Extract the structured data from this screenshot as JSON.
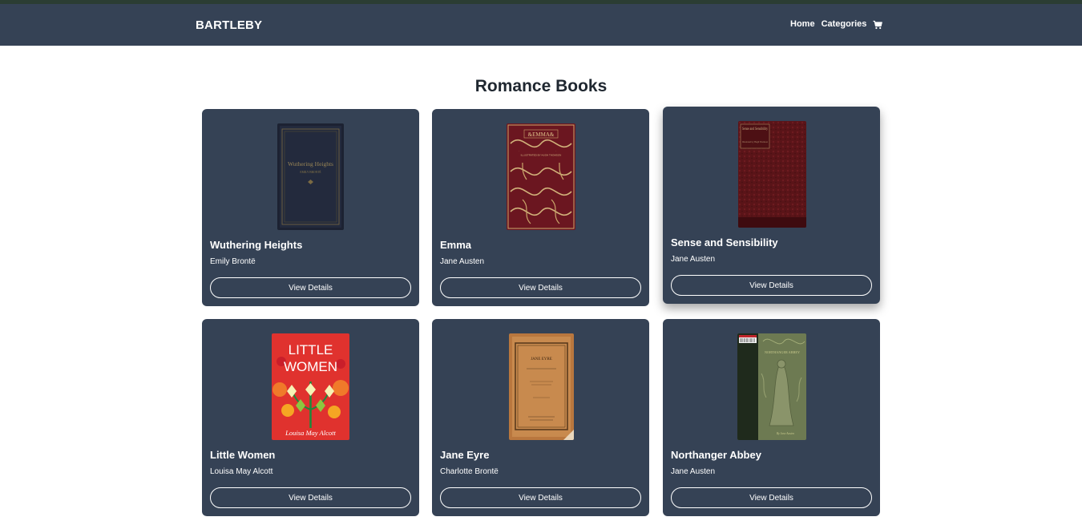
{
  "header": {
    "brand": "BARTLEBY",
    "nav": [
      "Home",
      "Categories"
    ],
    "cart_icon": "cart-icon"
  },
  "page": {
    "title": "Romance Books"
  },
  "books": [
    {
      "title": "Wuthering Heights",
      "author": "Emily Brontë",
      "button": "View Details",
      "cover_text": [
        "Wuthering Heights",
        "EMILY BRONTË"
      ]
    },
    {
      "title": "Emma",
      "author": "Jane Austen",
      "button": "View Details",
      "cover_text": [
        "&EMMA&",
        "ILLUSTRATED BY HUGH THOMSON"
      ]
    },
    {
      "title": "Sense and Sensibility",
      "author": "Jane Austen",
      "button": "View Details",
      "cover_text": [
        "Sense and Sensibility",
        "Illustrated by Hugh Thomson"
      ]
    },
    {
      "title": "Little Women",
      "author": "Louisa May Alcott",
      "button": "View Details",
      "cover_text": [
        "LITTLE",
        "WOMEN",
        "Louisa May Alcott"
      ]
    },
    {
      "title": "Jane Eyre",
      "author": "Charlotte Brontë",
      "button": "View Details",
      "cover_text": [
        "JANE EYRE"
      ]
    },
    {
      "title": "Northanger Abbey",
      "author": "Jane Austen",
      "button": "View Details",
      "cover_text": [
        "NORTHANGER ABBEY",
        "By Jane Austen"
      ]
    }
  ],
  "colors": {
    "navbar": "#354255",
    "top_strip": "#2b3d33",
    "card": "#354255",
    "background": "#ffffff"
  }
}
